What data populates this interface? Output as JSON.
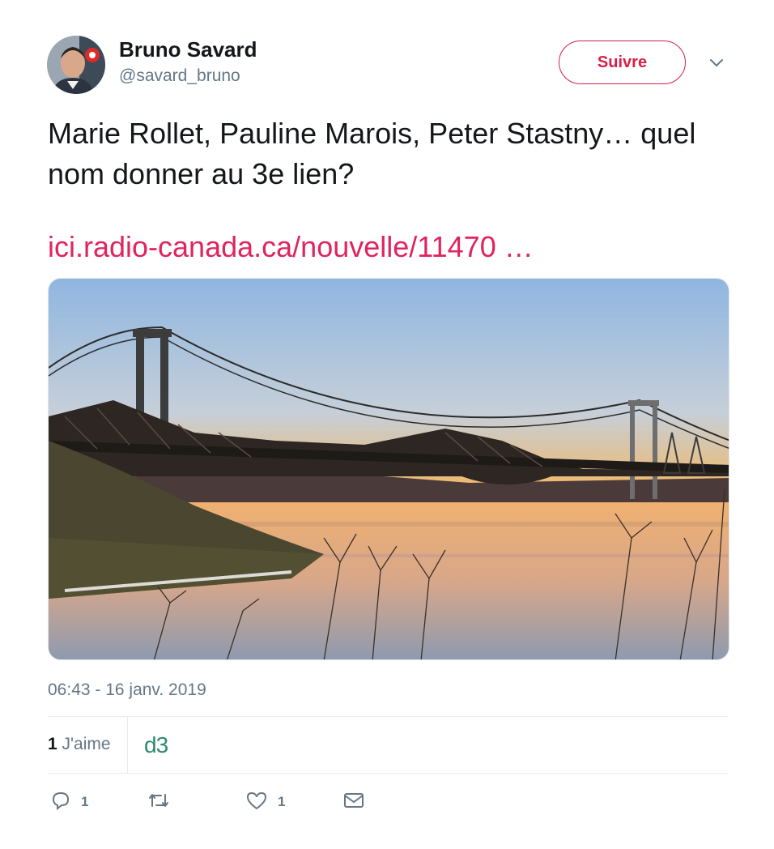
{
  "author": {
    "name": "Bruno Savard",
    "handle": "@savard_bruno"
  },
  "follow_button": "Suivre",
  "tweet": {
    "text": "Marie Rollet, Pauline Marois, Peter Stastny… quel nom donner au 3e lien?",
    "link": "ici.radio-canada.ca/nouvelle/11470 …"
  },
  "timestamp": "06:43 - 16 janv. 2019",
  "likes": {
    "count": "1",
    "label": "J'aime"
  },
  "liker_badge": "d3",
  "actions": {
    "reply_count": "1",
    "retweet_count": "",
    "like_count": "1"
  },
  "icons": [
    "avatar",
    "chevron-down-icon",
    "reply-icon",
    "retweet-icon",
    "heart-icon",
    "mail-icon"
  ],
  "colors": {
    "accent": "#e0245e",
    "follow": "#d6204a",
    "secondary_text": "#657786",
    "badge": "#2e8b6a"
  }
}
